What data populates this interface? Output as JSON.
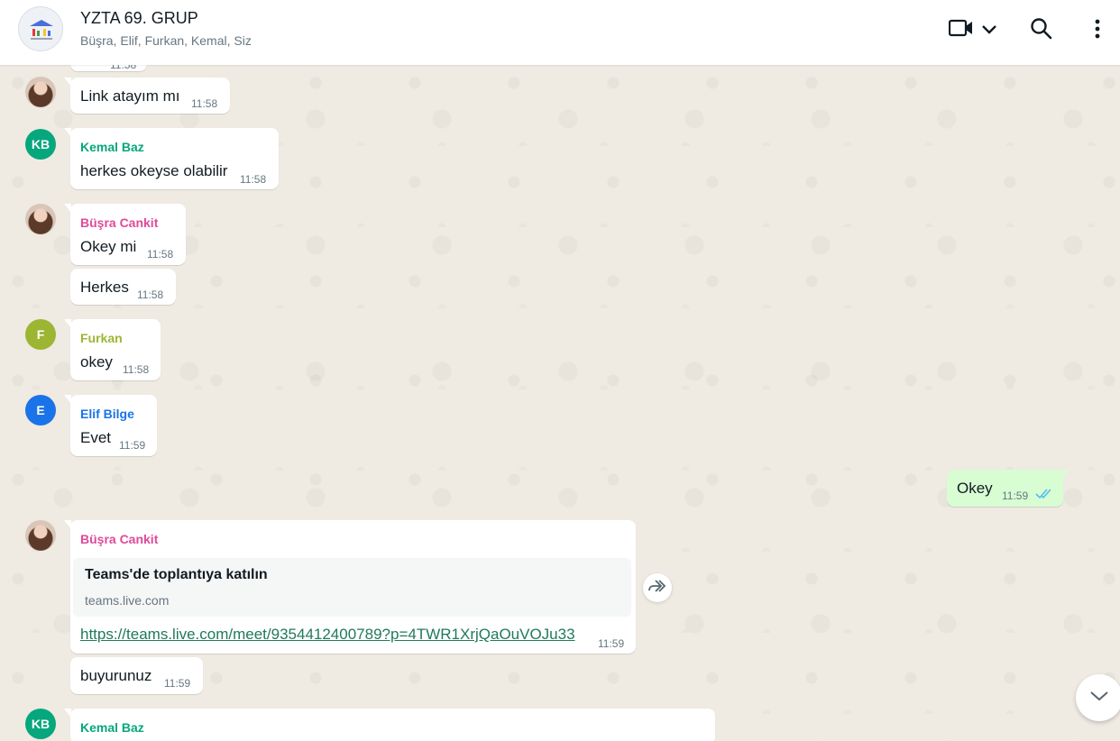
{
  "header": {
    "title": "YZTA 69. GRUP",
    "members": "Büşra, Elif, Furkan, Kemal, Siz",
    "icons": [
      "video-call-icon",
      "chevron-down-icon",
      "search-icon",
      "more-vert-icon"
    ]
  },
  "colors": {
    "kemal": "#06a77d",
    "busra": "#e0499b",
    "furkan": "#9cb633",
    "elif": "#027eb5",
    "outgoing_bubble": "#d9fdd3",
    "read_ticks": "#53bdeb"
  },
  "messages": [
    {
      "partial_time": "11:58"
    },
    {
      "text": "Link atayım mı",
      "time": "11:58"
    },
    {
      "sender": "Kemal Baz",
      "initials": "KB",
      "text": "herkes okeyse olabilir",
      "time": "11:58"
    },
    {
      "sender": "Büşra Cankit",
      "text": "Okey mi",
      "time": "11:58"
    },
    {
      "text": "Herkes",
      "time": "11:58"
    },
    {
      "sender": "Furkan",
      "initials": "F",
      "text": "okey",
      "time": "11:58"
    },
    {
      "sender": "Elif Bilge",
      "initials": "E",
      "text": "Evet",
      "time": "11:59"
    },
    {
      "text": "Okey",
      "time": "11:59",
      "outgoing": true
    },
    {
      "sender": "Büşra Cankit",
      "link_title": "Teams'de toplantıya katılın",
      "link_host": "teams.live.com",
      "text": "https://teams.live.com/meet/9354412400789?p=4TWR1XrjQaOuVOJu33",
      "time": "11:59"
    },
    {
      "text": "buyurunuz",
      "time": "11:59"
    },
    {
      "sender": "Kemal Baz",
      "initials": "KB"
    }
  ]
}
